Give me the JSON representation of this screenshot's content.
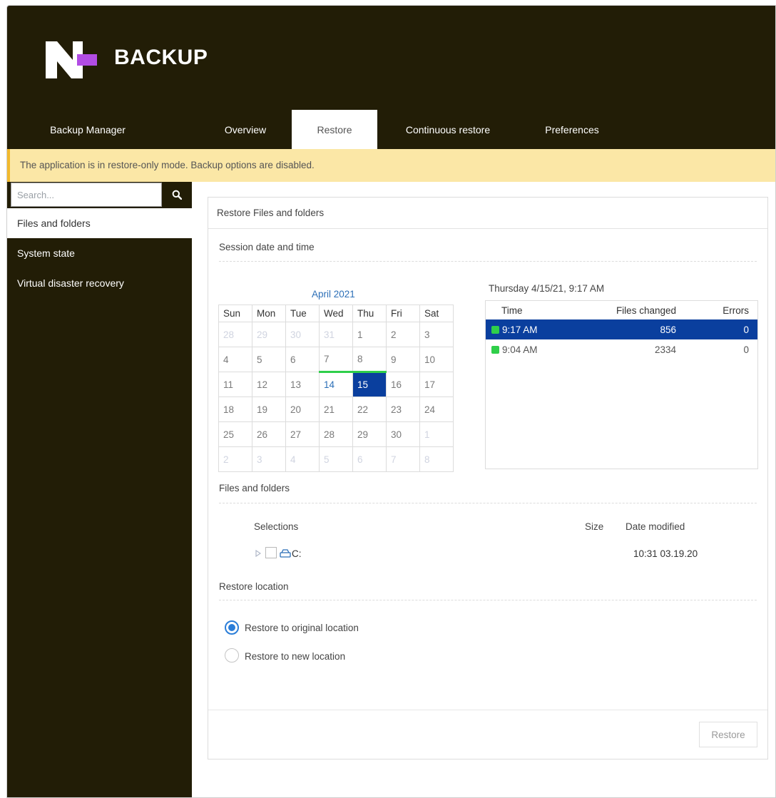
{
  "app": {
    "brand": "BACKUP"
  },
  "nav": {
    "tabs": [
      {
        "label": "Backup Manager"
      },
      {
        "label": "Overview"
      },
      {
        "label": "Restore"
      },
      {
        "label": "Continuous restore"
      },
      {
        "label": "Preferences"
      }
    ],
    "active": "Restore"
  },
  "banner": {
    "text": "The application is in restore-only mode. Backup options are disabled."
  },
  "sidebar": {
    "search_placeholder": "Search...",
    "items": [
      {
        "label": "Files and folders"
      },
      {
        "label": "System state"
      },
      {
        "label": "Virtual disaster recovery"
      }
    ],
    "active": "Files and folders"
  },
  "panel": {
    "title": "Restore Files and folders",
    "session_section": "Session date and time",
    "calendar": {
      "month": "April 2021",
      "weekdays": [
        "Sun",
        "Mon",
        "Tue",
        "Wed",
        "Thu",
        "Fri",
        "Sat"
      ],
      "weeks": [
        [
          "28",
          "29",
          "30",
          "31",
          "1",
          "2",
          "3"
        ],
        [
          "4",
          "5",
          "6",
          "7",
          "8",
          "9",
          "10"
        ],
        [
          "11",
          "12",
          "13",
          "14",
          "15",
          "16",
          "17"
        ],
        [
          "18",
          "19",
          "20",
          "21",
          "22",
          "23",
          "24"
        ],
        [
          "25",
          "26",
          "27",
          "28",
          "29",
          "30",
          "1"
        ],
        [
          "2",
          "3",
          "4",
          "5",
          "6",
          "7",
          "8"
        ]
      ],
      "selected_day": "15",
      "backup_days": [
        "14",
        "15"
      ]
    },
    "session_date": "Thursday 4/15/21, 9:17 AM",
    "sessions": {
      "headers": {
        "time": "Time",
        "files": "Files changed",
        "errors": "Errors"
      },
      "rows": [
        {
          "time": "9:17 AM",
          "files": "856",
          "errors": "0"
        },
        {
          "time": "9:04 AM",
          "files": "2334",
          "errors": "0"
        }
      ],
      "selected_index": 0
    },
    "files_section": "Files and folders",
    "files_headers": {
      "selections": "Selections",
      "size": "Size",
      "date": "Date modified"
    },
    "files": [
      {
        "name": "C:",
        "size": "",
        "date": "10:31 03.19.20"
      }
    ],
    "location_section": "Restore location",
    "location_options": [
      {
        "label": "Restore to original location",
        "checked": true
      },
      {
        "label": "Restore to new location",
        "checked": false
      }
    ],
    "restore_button": "Restore"
  },
  "colors": {
    "header_bg": "#221d06",
    "logo_accent": "#b24ce4",
    "banner_bg": "#fbe7a6",
    "selected_blue": "#0a3f9e",
    "backup_green": "#2fcf4a",
    "link_blue": "#2c6fb7"
  }
}
